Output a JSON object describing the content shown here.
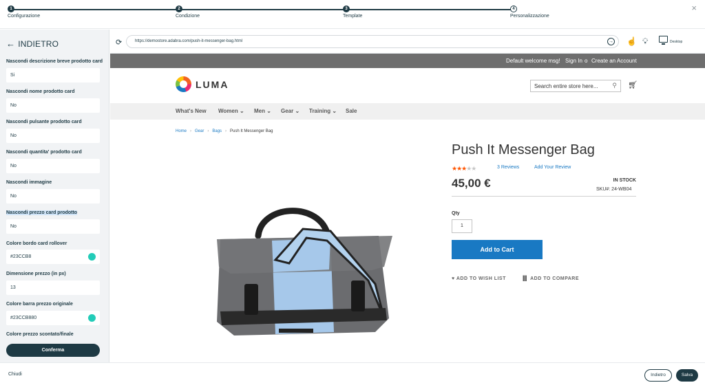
{
  "stepper": {
    "steps": [
      {
        "num": "1",
        "label": "Configurazione"
      },
      {
        "num": "2",
        "label": "Condizione"
      },
      {
        "num": "3",
        "label": "Template"
      },
      {
        "num": "4",
        "label": "Personalizzazione"
      }
    ],
    "close_icon": "×"
  },
  "sidebar": {
    "back_label": "INDIETRO",
    "fields": [
      {
        "label": "Nascondi descrizione breve prodotto card",
        "value": "Si"
      },
      {
        "label": "Nascondi nome prodotto card",
        "value": "No"
      },
      {
        "label": "Nascondi pulsante prodotto card",
        "value": "No"
      },
      {
        "label": "Nascondi quantita' prodotto card",
        "value": "No"
      },
      {
        "label": "Nascondi immagine",
        "value": "No"
      },
      {
        "label": "Nascondi prezzo card prodotto",
        "value": "No"
      },
      {
        "label": "Colore bordo card rollover",
        "value": "#23CCB8",
        "color": "#23ccb8"
      },
      {
        "label": "Dimensione prezzo (in px)",
        "value": "13"
      },
      {
        "label": "Colore barra prezzo originale",
        "value": "#23CCB880",
        "color": "#23ccb8"
      },
      {
        "label": "Colore prezzo scontato/finale"
      }
    ],
    "confirm_label": "Conferma"
  },
  "browser": {
    "url": "https://demostore.adabra.com/push-it-messenger-bag.html",
    "device_label": "Desktop"
  },
  "store": {
    "welcome": "Default welcome msg!",
    "sign_in": "Sign In",
    "separator": "o",
    "create_account": "Create an Account",
    "logo_text": "LUMA",
    "search_placeholder": "Search entire store here...",
    "nav": [
      "What's New",
      "Women",
      "Men",
      "Gear",
      "Training",
      "Sale"
    ],
    "breadcrumb": [
      "Home",
      "Gear",
      "Bags",
      "Push It Messenger Bag"
    ],
    "product": {
      "title": "Push It Messenger Bag",
      "rating_stars": 3,
      "reviews": "3  Reviews",
      "add_review": "Add Your Review",
      "price": "45,00 €",
      "stock": "IN STOCK",
      "sku": "SKU#:  24-WB04",
      "qty_label": "Qty",
      "qty_value": "1",
      "add_to_cart": "Add to Cart",
      "wish_list": "ADD TO WISH LIST",
      "compare": "ADD TO COMPARE"
    }
  },
  "footer": {
    "close_label": "Chiudi",
    "back_label": "Indietro",
    "save_label": "Salva"
  },
  "colors": {
    "primary": "#1e3a44",
    "accent": "#23ccb8",
    "luma_blue": "#1979c3"
  }
}
